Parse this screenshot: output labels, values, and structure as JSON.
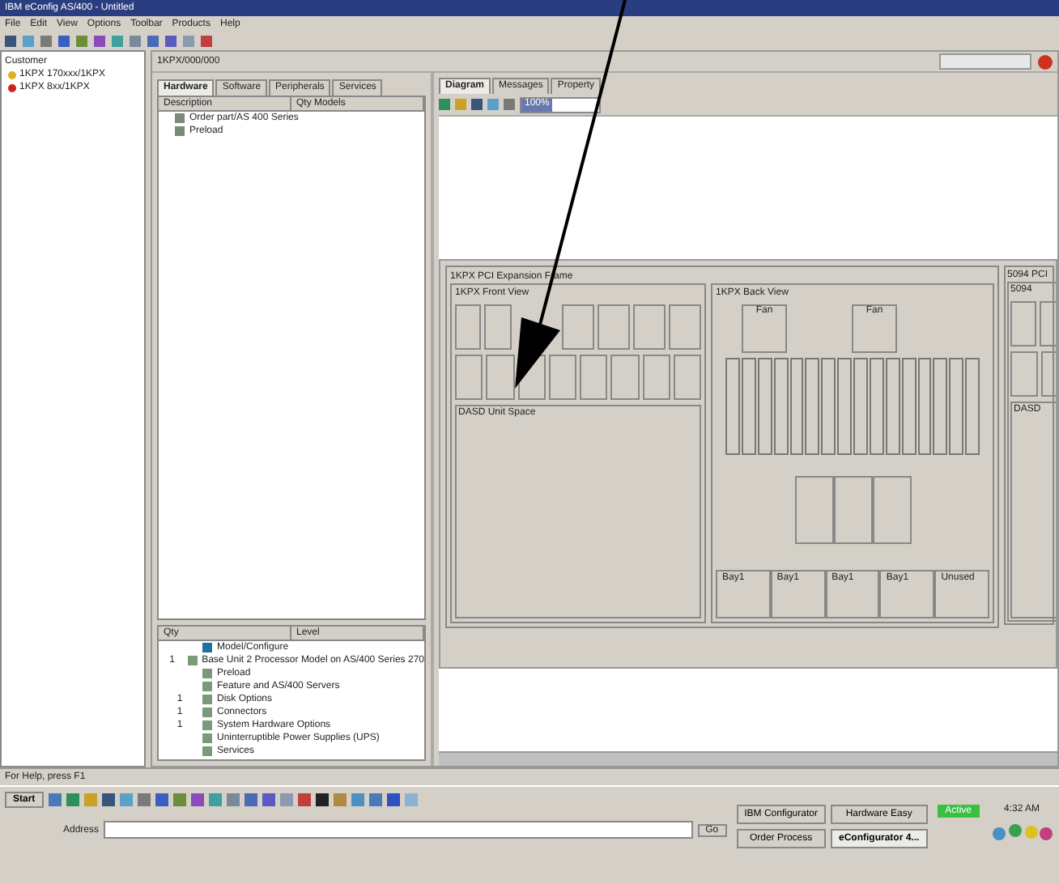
{
  "window": {
    "title": "IBM eConfig AS/400 - Untitled"
  },
  "menu": [
    "File",
    "Edit",
    "View",
    "Options",
    "Toolbar",
    "Products",
    "Help"
  ],
  "explorer": {
    "items": [
      {
        "label": "Customer",
        "children": [
          {
            "label": "1KPX 170xxx/1KPX"
          },
          {
            "label": "1KPX 8xx/1KPX"
          }
        ]
      }
    ]
  },
  "document": {
    "title": "1KPX/000/000",
    "left_tabs": [
      {
        "label": "Hardware",
        "selected": true
      },
      {
        "label": "Software",
        "selected": false
      },
      {
        "label": "Peripherals",
        "selected": false
      },
      {
        "label": "Services",
        "selected": false
      }
    ],
    "list": {
      "columns": [
        "Description",
        "Qty Models"
      ],
      "rows": [
        "Order part/AS 400 Series",
        "Preload"
      ]
    },
    "outline": {
      "columns": [
        "Qty",
        "Level"
      ],
      "items": [
        {
          "label": "Model/Configure"
        },
        {
          "qty": "1",
          "label": "Base Unit 2 Processor Model on AS/400 Series 270"
        },
        {
          "label": "Preload"
        },
        {
          "label": "Feature and AS/400 Servers"
        },
        {
          "qty": "1",
          "label": "Disk Options"
        },
        {
          "qty": "1",
          "label": "Connectors"
        },
        {
          "qty": "1",
          "label": "System Hardware Options"
        },
        {
          "label": "Uninterruptible Power Supplies (UPS)"
        },
        {
          "label": "Services"
        }
      ]
    },
    "right_tabs": [
      {
        "label": "Diagram",
        "selected": true
      },
      {
        "label": "Messages",
        "selected": false
      },
      {
        "label": "Property",
        "selected": false
      }
    ],
    "zoom_value": "100%",
    "diagram": {
      "frames": [
        {
          "title": "1KPX PCI Expansion Frame",
          "front": {
            "title": "1KPX Front View",
            "space": "DASD Unit Space"
          },
          "back": {
            "title": "1KPX Back View",
            "fans": [
              "Fan",
              "Fan"
            ],
            "bays": [
              "Bay1",
              "Bay1",
              "Bay1",
              "Bay1",
              "Unused"
            ]
          }
        },
        {
          "title": "5094 PCI",
          "front": {
            "title": "5094",
            "space": "DASD"
          }
        }
      ]
    }
  },
  "status_bar": "For Help, press F1",
  "taskbar": {
    "start": "Start",
    "tasks": [
      {
        "label": "IBM Configurator",
        "selected": false
      },
      {
        "label": "Hardware Easy",
        "selected": false
      },
      {
        "label": "Order Process",
        "selected": false
      },
      {
        "label": "eConfigurator 4...",
        "selected": true
      }
    ],
    "tray_badge": "Active",
    "clock": "4:32 AM",
    "address_label": "Address",
    "go": "Go"
  }
}
